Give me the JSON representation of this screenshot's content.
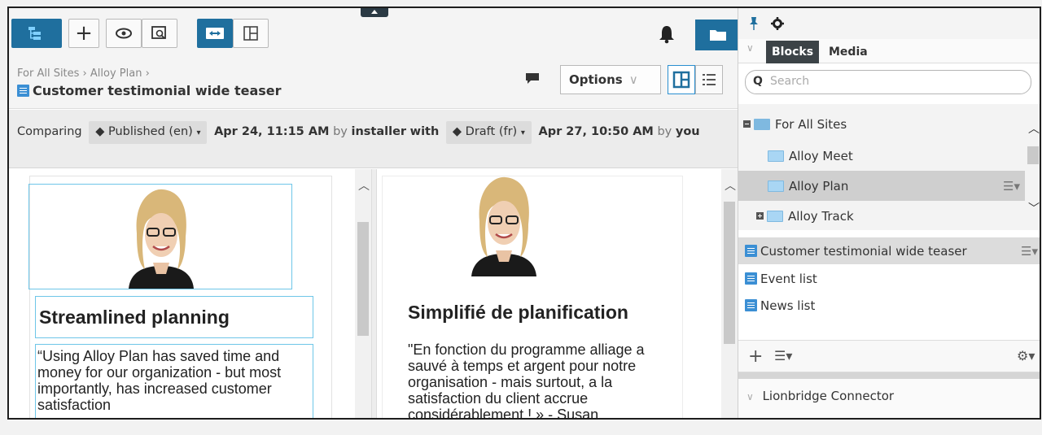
{
  "toolbar": {
    "add_label": "+",
    "grip_label": ""
  },
  "header": {
    "breadcrumb": "For All Sites › Alloy Plan ›",
    "title": "Customer testimonial wide teaser",
    "options_label": "Options",
    "options_chevron": "∨"
  },
  "compare": {
    "prefix": "Comparing",
    "left_version": "Published (en)",
    "left_date": "Apr 24, 11:15 AM",
    "by1": "by",
    "left_user": "installer",
    "with": "with",
    "right_version": "Draft (fr)",
    "right_date": "Apr 27, 10:50 AM",
    "by2": "by",
    "right_user": "you"
  },
  "left_block": {
    "title": "Streamlined planning",
    "quote": "“Using Alloy Plan has saved time and money for our organization - but most importantly, has increased customer satisfaction"
  },
  "right_block": {
    "title": "Simplifié de planification",
    "quote": "\"En fonction du programme alliage a sauvé à temps et argent pour notre organisation - mais surtout, a la satisfaction du client accrue considérablement ! » - Susan"
  },
  "side": {
    "tabs": [
      "Blocks",
      "Media"
    ],
    "search_placeholder": "Search",
    "tree": [
      {
        "label": "For All Sites"
      },
      {
        "label": "Alloy Meet"
      },
      {
        "label": "Alloy Plan"
      },
      {
        "label": "Alloy Track"
      }
    ],
    "blocks": [
      {
        "label": "Customer testimonial wide teaser"
      },
      {
        "label": "Event list"
      },
      {
        "label": "News list"
      }
    ],
    "connector": "Lionbridge Connector"
  },
  "colors": {
    "accent": "#1f6f9e",
    "doc_icon": "#3b8fd4",
    "selection": "#6ec6e8"
  },
  "icons": [
    "tree-icon",
    "plus-icon",
    "eye-icon",
    "preview-icon",
    "compare-icon",
    "layout-icon",
    "bell-icon",
    "folder-icon",
    "comment-icon",
    "pin-icon",
    "gear-icon",
    "search-icon",
    "menu-icon"
  ]
}
